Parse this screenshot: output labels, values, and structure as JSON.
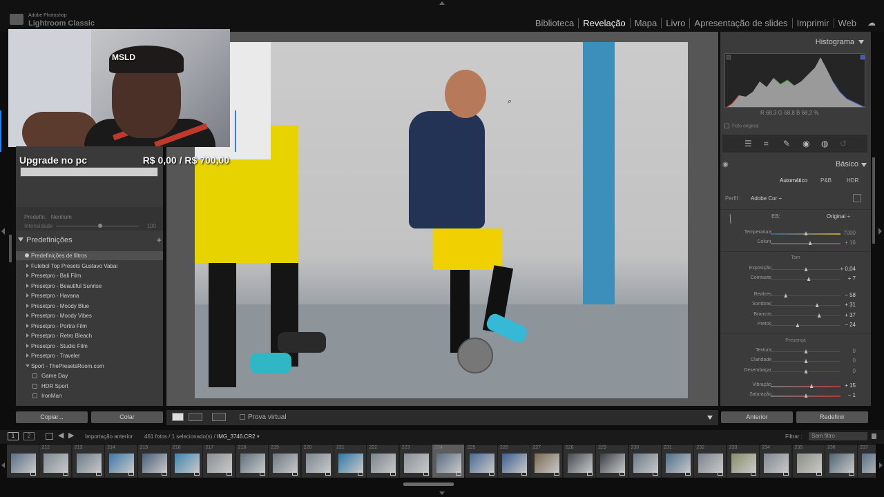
{
  "app": {
    "vendor": "Adobe Photoshop",
    "product": "Lightroom Classic"
  },
  "modules": [
    {
      "label": "Biblioteca",
      "active": false
    },
    {
      "label": "Revelação",
      "active": true
    },
    {
      "label": "Mapa",
      "active": false
    },
    {
      "label": "Livro",
      "active": false
    },
    {
      "label": "Apresentação de slides",
      "active": false
    },
    {
      "label": "Imprimir",
      "active": false
    },
    {
      "label": "Web",
      "active": false
    }
  ],
  "overlay": {
    "camera_logo": "MSLD",
    "title": "Upgrade no pc",
    "price": "R$ 0,00 / R$ 700,00"
  },
  "left_panel": {
    "preset_label": "Predefin.",
    "preset_value": "Nenhum",
    "intensity_label": "Intensidade",
    "intensity_value": "100",
    "intensity_level": 0.55,
    "presets_title": "Predefinições",
    "presets": [
      {
        "label": "Predefinições de filtros",
        "kind": "dot",
        "selected": true
      },
      {
        "label": "Futebol Top Presets Gustavo Vabai",
        "kind": "folder"
      },
      {
        "label": "Presetpro - Bali Film",
        "kind": "folder"
      },
      {
        "label": "Presetpro - Beautiful Sunrise",
        "kind": "folder"
      },
      {
        "label": "Presetpro - Havana",
        "kind": "folder"
      },
      {
        "label": "Presetpro - Moody Blue",
        "kind": "folder"
      },
      {
        "label": "Presetpro - Moody Vibes",
        "kind": "folder"
      },
      {
        "label": "Presetpro - Portra Film",
        "kind": "folder"
      },
      {
        "label": "Presetpro - Retro Bleach",
        "kind": "folder"
      },
      {
        "label": "Presetpro - Studio Film",
        "kind": "folder"
      },
      {
        "label": "Presetpro - Traveler",
        "kind": "folder"
      },
      {
        "label": "Sport - ThePresetsRoom.com",
        "kind": "folder-open"
      },
      {
        "label": "Game Day",
        "kind": "item"
      },
      {
        "label": "HDR Sport",
        "kind": "item"
      },
      {
        "label": "IronMan",
        "kind": "item"
      }
    ],
    "copy_label": "Copiar...",
    "paste_label": "Colar"
  },
  "toolbar": {
    "soft_proof_label": "Prova virtual"
  },
  "right_panel": {
    "histogram_title": "Histograma",
    "rgb_values": "R  68,3  G  68,8  B  68,2  %",
    "foto_original": "Foto original",
    "basic_title": "Básico",
    "treatments": [
      "Automático",
      "P&B",
      "HDR"
    ],
    "profile_label": "Perfil :",
    "profile_value": "Adobe Cor ÷",
    "wb_label": "EB:",
    "wb_value": "Original ÷",
    "tone_label": "Tom",
    "presence_label": "Presença",
    "sliders": [
      {
        "label": "Temperatura",
        "value": "7000",
        "level": 0.5,
        "style": "temp",
        "dim": true
      },
      {
        "label": "Colorir",
        "value": "+ 16",
        "level": 0.56,
        "style": "tint",
        "dim": true
      },
      {
        "label": "Exposição",
        "value": "+ 0,04",
        "level": 0.5,
        "style": "plain"
      },
      {
        "label": "Contraste",
        "value": "+ 7",
        "level": 0.54,
        "style": "plain"
      },
      {
        "label": "Realces",
        "value": "− 58",
        "level": 0.21,
        "style": "plain"
      },
      {
        "label": "Sombras",
        "value": "+ 31",
        "level": 0.66,
        "style": "plain"
      },
      {
        "label": "Brancos",
        "value": "+ 37",
        "level": 0.69,
        "style": "plain"
      },
      {
        "label": "Pretos",
        "value": "− 24",
        "level": 0.38,
        "style": "plain"
      },
      {
        "label": "Textura",
        "value": "0",
        "level": 0.5,
        "style": "plain",
        "dim": true
      },
      {
        "label": "Claridade",
        "value": "0",
        "level": 0.5,
        "style": "plain",
        "dim": true
      },
      {
        "label": "Desembaçar",
        "value": "0",
        "level": 0.5,
        "style": "plain",
        "dim": true
      },
      {
        "label": "Vibração",
        "value": "+ 15",
        "level": 0.58,
        "style": "sat"
      },
      {
        "label": "Saturação",
        "value": "− 1",
        "level": 0.5,
        "style": "sat"
      }
    ],
    "prev_label": "Anterior",
    "reset_label": "Redefinir"
  },
  "filmstrip": {
    "source": "Importação anterior",
    "count": "461 fotos / 1 selecionado(s) /",
    "filename": "IMG_3746.CR2",
    "filter_label": "Filtrar :",
    "filter_value": "Sem filtro",
    "numbers": [
      "",
      "212",
      "213",
      "214",
      "215",
      "216",
      "217",
      "218",
      "219",
      "220",
      "221",
      "222",
      "223",
      "224",
      "225",
      "226",
      "227",
      "228",
      "229",
      "230",
      "231",
      "232",
      "233",
      "234",
      "235",
      "236",
      "237"
    ],
    "selected_index": 13
  },
  "colors": {
    "accent": "#f0f0f0",
    "panel": "#3b3b3b",
    "main_bg": "#565656"
  }
}
